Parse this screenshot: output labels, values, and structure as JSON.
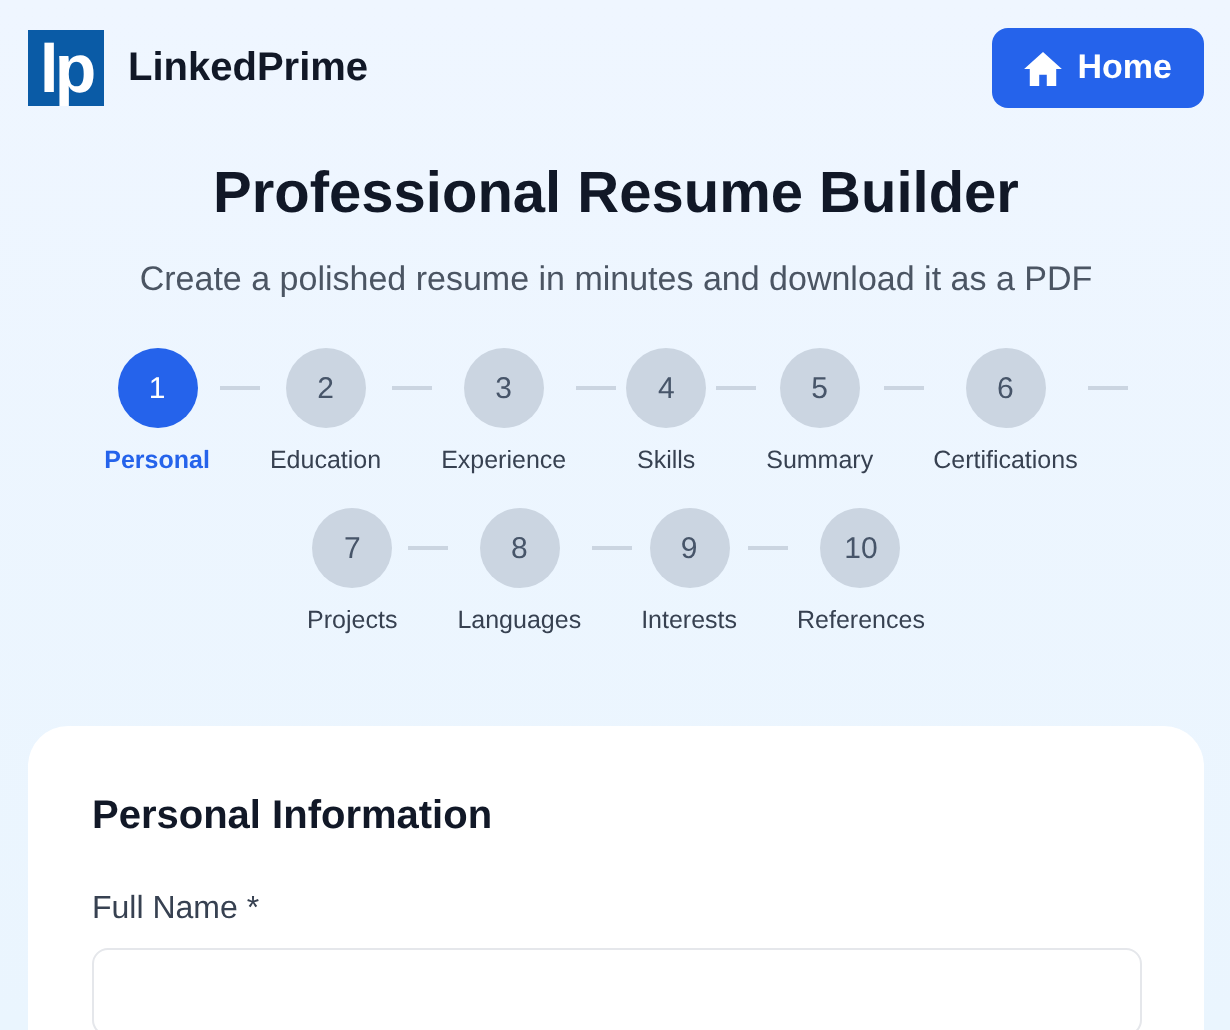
{
  "header": {
    "logo": "lp",
    "brand": "LinkedPrime",
    "home_button": "Home"
  },
  "title": "Professional Resume Builder",
  "subtitle": "Create a polished resume in minutes and download it as a PDF",
  "steps": [
    {
      "number": "1",
      "label": "Personal",
      "selected": true
    },
    {
      "number": "2",
      "label": "Education",
      "selected": false
    },
    {
      "number": "3",
      "label": "Experience",
      "selected": false
    },
    {
      "number": "4",
      "label": "Skills",
      "selected": false
    },
    {
      "number": "5",
      "label": "Summary",
      "selected": false
    },
    {
      "number": "6",
      "label": "Certifications",
      "selected": false
    },
    {
      "number": "7",
      "label": "Projects",
      "selected": false
    },
    {
      "number": "8",
      "label": "Languages",
      "selected": false
    },
    {
      "number": "9",
      "label": "Interests",
      "selected": false
    },
    {
      "number": "10",
      "label": "References",
      "selected": false
    }
  ],
  "form": {
    "heading": "Personal Information",
    "fields": [
      {
        "label": "Full Name *"
      }
    ]
  }
}
